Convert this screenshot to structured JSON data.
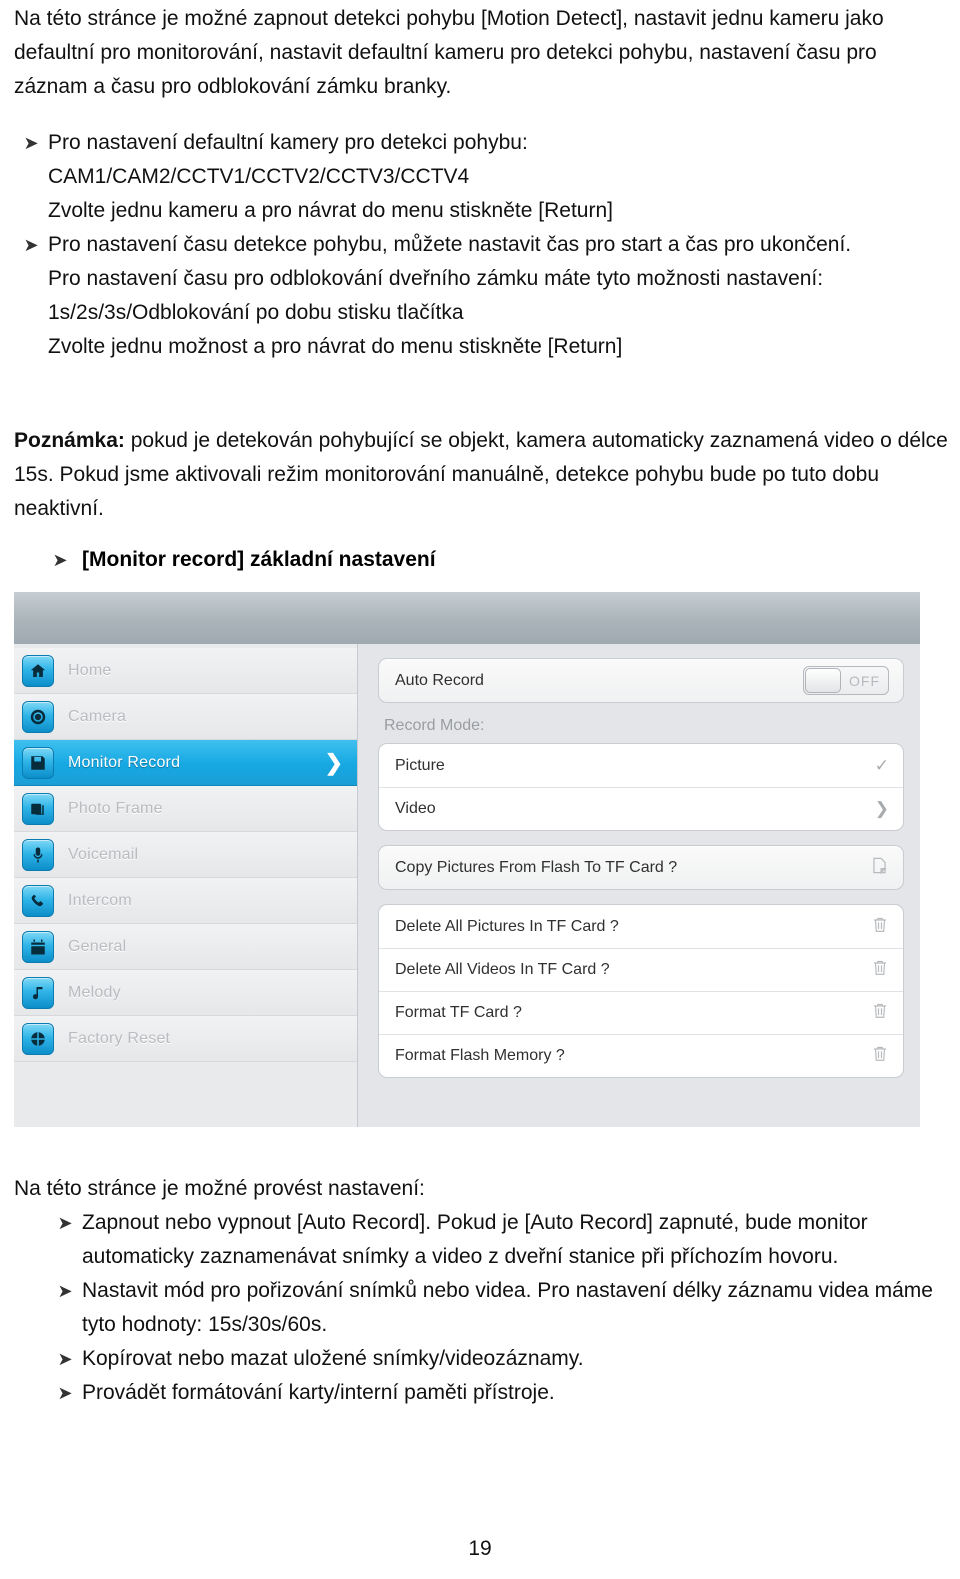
{
  "document": {
    "intro_paragraph": "Na této stránce je možné zapnout detekci pohybu [Motion Detect], nastavit jednu kameru jako defaultní pro monitorování, nastavit defaultní kameru pro detekci pohybu, nastavení času pro záznam a času pro odblokování zámku branky.",
    "bullet_marker": "➤",
    "bullets": [
      {
        "lead": "Pro nastavení defaultní kamery pro detekci pohybu:",
        "sub_lines": [
          "CAM1/CAM2/CCTV1/CCTV2/CCTV3/CCTV4",
          "Zvolte jednu kameru a pro návrat do menu stiskněte [Return]"
        ]
      },
      {
        "lead": "Pro nastavení času detekce pohybu, můžete nastavit čas pro start a čas pro ukončení.",
        "sub_lines": [
          "Pro nastavení času pro odblokování dveřního zámku máte tyto možnosti nastavení:",
          "1s/2s/3s/Odblokování po dobu stisku tlačítka",
          "Zvolte jednu možnost a pro návrat do menu stiskněte [Return]"
        ]
      }
    ],
    "note_label": "Poznámka:",
    "note_text": " pokud je detekován pohybující se objekt, kamera automaticky zaznamená video o délce 15s. Pokud jsme aktivovali režim monitorování manuálně, detekce pohybu bude po tuto dobu neaktivní.",
    "section_heading": "[Monitor record] základní nastavení",
    "bottom_lead": "Na této stránce je možné provést nastavení:",
    "bottom_bullets": [
      "Zapnout nebo vypnout [Auto Record]. Pokud je [Auto Record] zapnuté, bude monitor automaticky zaznamenávat snímky a video z dveřní stanice při příchozím hovoru.",
      "Nastavit mód pro pořizování snímků nebo videa. Pro nastavení délky záznamu videa máme tyto hodnoty: 15s/30s/60s.",
      "Kopírovat nebo mazat uložené snímky/videozáznamy.",
      "Provádět formátování karty/interní paměti přístroje."
    ],
    "page_number": "19"
  },
  "device_ui": {
    "accent_color": "#16a8e2",
    "sidebar": {
      "items": [
        {
          "label": "Home",
          "icon": "home-icon",
          "active": false
        },
        {
          "label": "Camera",
          "icon": "camera-icon",
          "active": false
        },
        {
          "label": "Monitor Record",
          "icon": "floppy-disk-icon",
          "active": true,
          "arrow": "❯"
        },
        {
          "label": "Photo Frame",
          "icon": "photo-frame-icon",
          "active": false
        },
        {
          "label": "Voicemail",
          "icon": "microphone-icon",
          "active": false
        },
        {
          "label": "Intercom",
          "icon": "phone-handset-icon",
          "active": false
        },
        {
          "label": "General",
          "icon": "calendar-icon",
          "active": false
        },
        {
          "label": "Melody",
          "icon": "music-note-icon",
          "active": false
        },
        {
          "label": "Factory Reset",
          "icon": "factory-reset-icon",
          "active": false
        }
      ]
    },
    "content": {
      "auto_record": {
        "label": "Auto Record",
        "toggle_state": "OFF"
      },
      "record_mode_label": "Record Mode:",
      "record_mode_options": [
        {
          "label": "Picture",
          "selected": true,
          "accessory": "✓"
        },
        {
          "label": "Video",
          "selected": false,
          "accessory": "❯"
        }
      ],
      "copy_action": {
        "label": "Copy Pictures From Flash To TF Card ?",
        "icon": "copy-page-icon"
      },
      "destructive_actions": [
        {
          "label": "Delete All Pictures In TF Card ?",
          "icon": "trash-icon"
        },
        {
          "label": "Delete All Videos In TF Card ?",
          "icon": "trash-icon"
        },
        {
          "label": "Format TF Card ?",
          "icon": "trash-icon"
        },
        {
          "label": "Format Flash Memory ?",
          "icon": "trash-icon"
        }
      ]
    }
  }
}
